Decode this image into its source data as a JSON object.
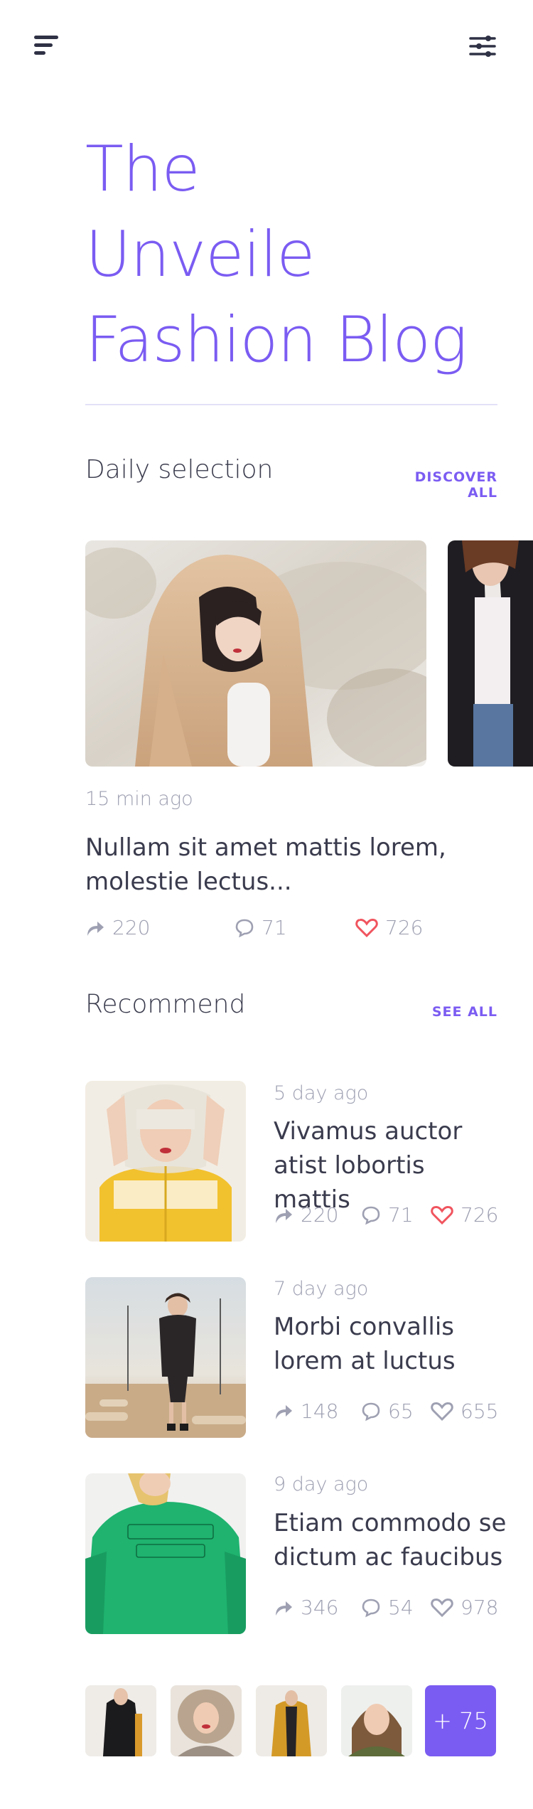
{
  "hero": {
    "title_lines": [
      "The",
      "Unveile",
      "Fashion Blog"
    ]
  },
  "daily": {
    "title": "Daily selection",
    "link": "DISCOVER ALL",
    "featured": {
      "time": "15 min ago",
      "title": "Nullam sit amet mattis lorem, molestie lectus...",
      "shares": "220",
      "comments": "71",
      "likes": "726",
      "liked": true
    }
  },
  "recommend": {
    "title": "Recommend",
    "link": "SEE ALL",
    "items": [
      {
        "time": "5 day ago",
        "title": "Vivamus auctor atist lobortis mattis",
        "shares": "220",
        "comments": "71",
        "likes": "726",
        "liked": true
      },
      {
        "time": "7 day ago",
        "title": "Morbi convallis lorem at luctus",
        "shares": "148",
        "comments": "65",
        "likes": "655",
        "liked": false
      },
      {
        "time": "9 day ago",
        "title": "Etiam commodo se dictum ac faucibus",
        "shares": "346",
        "comments": "54",
        "likes": "978",
        "liked": false
      }
    ]
  },
  "gallery": {
    "more_label": "+ 75"
  },
  "colors": {
    "accent": "#7b5cf2",
    "like": "#f0545e",
    "text": "#3a3b4d",
    "muted": "#9ea0b2"
  },
  "icons": [
    "menu-icon",
    "filter-icon",
    "share-icon",
    "comment-icon",
    "heart-icon"
  ]
}
